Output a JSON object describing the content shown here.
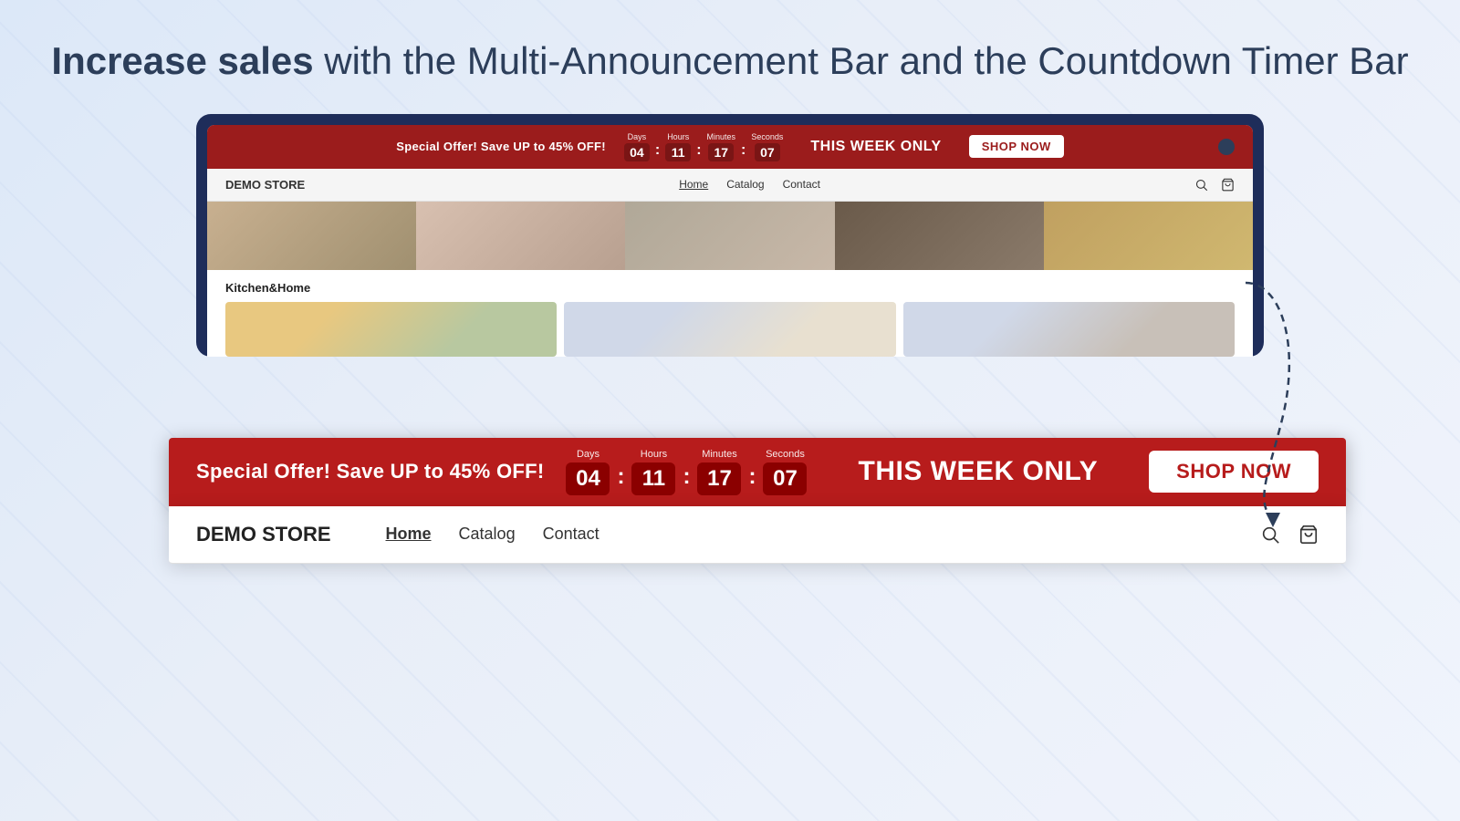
{
  "page": {
    "heading_bold": "Increase sales",
    "heading_rest": " with the Multi-Announcement Bar and the Countdown Timer Bar"
  },
  "announcement_bar": {
    "text": "Special Offer! Save UP to 45% OFF!",
    "days_label": "Days",
    "days_value": "04",
    "hours_label": "Hours",
    "hours_value": "11",
    "minutes_label": "Minutes",
    "minutes_value": "17",
    "seconds_label": "Seconds",
    "seconds_value": "07",
    "this_week": "THIS WEEK ONLY",
    "shop_now": "SHOP NOW"
  },
  "store_nav": {
    "logo": "DEMO STORE",
    "links": [
      "Home",
      "Catalog",
      "Contact"
    ]
  },
  "zoomed_store_nav": {
    "logo": "DEMO STORE",
    "links": [
      "Home",
      "Catalog",
      "Contact"
    ]
  },
  "bottom_section": {
    "title": "Kitchen&Home"
  }
}
